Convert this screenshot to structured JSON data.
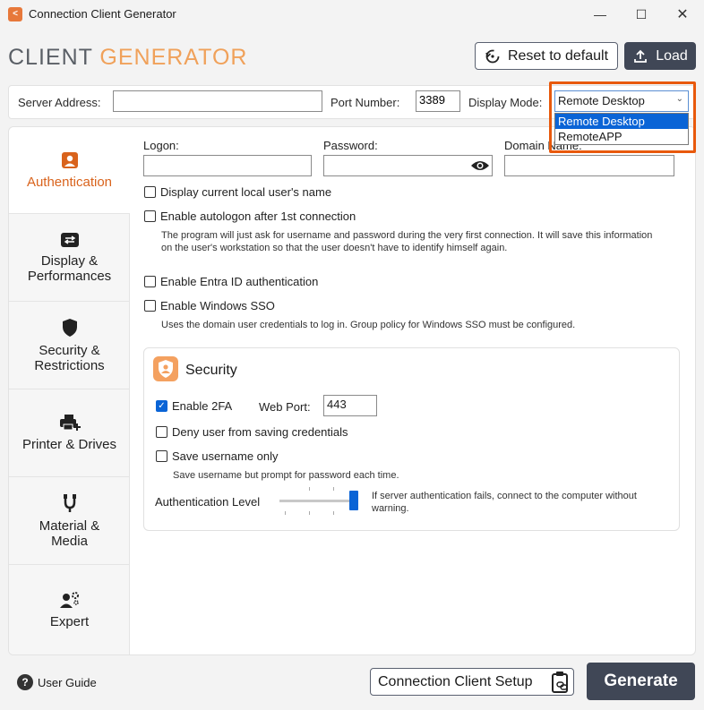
{
  "window": {
    "title": "Connection Client Generator",
    "icon": "app-logo-icon",
    "controls": [
      "minimize-icon",
      "maximize-icon",
      "close-icon"
    ]
  },
  "header": {
    "brand_part1": "CLIENT",
    "brand_part2": "GENERATOR",
    "reset_label": "Reset to default",
    "load_label": "Load"
  },
  "server": {
    "address_label": "Server Address:",
    "address_value": "",
    "port_label": "Port Number:",
    "port_value": "3389",
    "display_mode_label": "Display Mode:",
    "display_mode_value": "Remote Desktop",
    "display_mode_options": [
      "Remote Desktop",
      "RemoteAPP"
    ]
  },
  "nav": {
    "authentication": "Authentication",
    "display_line1": "Display &",
    "display_line2": "Performances",
    "security_line1": "Security &",
    "security_line2": "Restrictions",
    "printer": "Printer & Drives",
    "material_line1": "Material &",
    "material_line2": "Media",
    "expert": "Expert"
  },
  "auth": {
    "logon_label": "Logon:",
    "logon_value": "",
    "password_label": "Password:",
    "password_value": "",
    "domain_label": "Domain Name:",
    "domain_value": "",
    "display_local_user": "Display current local user's name",
    "autologon": "Enable autologon after 1st connection",
    "autologon_help": "The program will just ask for username and password during the very first connection. It will save this information on the user's workstation so that the user doesn't have to identify himself again.",
    "entra": "Enable Entra ID authentication",
    "sso": "Enable Windows SSO",
    "sso_help": "Uses the domain user credentials to log in. Group policy for Windows SSO must be configured."
  },
  "security": {
    "title": "Security",
    "enable_2fa": "Enable 2FA",
    "enable_2fa_checked": true,
    "web_port_label": "Web Port:",
    "web_port_value": "443",
    "deny_saving": "Deny user from saving credentials",
    "save_username": "Save username only",
    "save_username_help": "Save username but prompt for password each time.",
    "auth_level_label": "Authentication Level",
    "auth_level_value": 1.0,
    "auth_level_help": "If server authentication fails, connect to the computer without warning."
  },
  "footer": {
    "user_guide": "User Guide",
    "setup_label": "Connection Client Setup",
    "generate_label": "Generate"
  },
  "colors": {
    "accent_orange": "#e8590c",
    "brand_orange": "#f0a15a",
    "primary_blue": "#0a64d6",
    "dark_button": "#404756"
  }
}
